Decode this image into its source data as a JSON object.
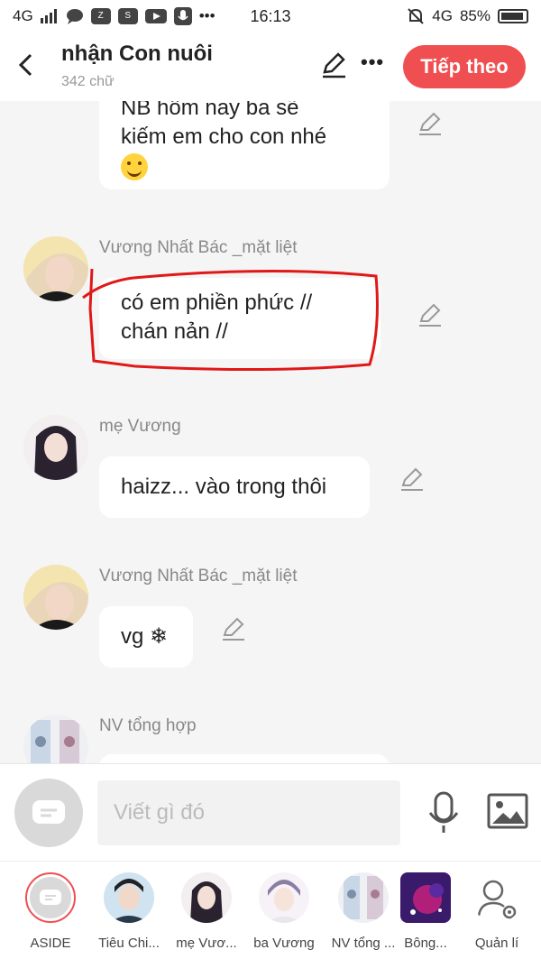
{
  "status_bar": {
    "network_left": "4G",
    "time": "16:13",
    "network_right": "4G",
    "battery": "85%"
  },
  "header": {
    "title": "nhận Con nuôi",
    "subtitle": "342 chữ",
    "next_label": "Tiếp theo"
  },
  "messages": [
    {
      "sender": "",
      "lines": [
        "NB hôm nay ba sẽ",
        "kiếm em cho con nhé"
      ],
      "emoji": "smile-emoji"
    },
    {
      "sender": "Vương Nhất Bác _mặt liệt",
      "lines": [
        "có em phiền phức //",
        "chán nản //"
      ],
      "highlighted": true
    },
    {
      "sender": "mẹ Vương",
      "lines": [
        "haizz... vào trong thôi"
      ]
    },
    {
      "sender": "Vương Nhất Bác _mặt liệt",
      "lines": [
        "vg ❄"
      ]
    },
    {
      "sender": "NV tổng hợp",
      "lines": []
    }
  ],
  "composer": {
    "placeholder": "Viết gì đó"
  },
  "characters": [
    {
      "label": "ASIDE"
    },
    {
      "label": "Tiêu Chi..."
    },
    {
      "label": "mẹ Vươ..."
    },
    {
      "label": "ba Vương"
    },
    {
      "label": "NV tổng ..."
    },
    {
      "label": "Bông..."
    },
    {
      "label": "Quản lí"
    }
  ],
  "colors": {
    "accent": "#f04f52",
    "highlight_stroke": "#e01818",
    "background": "#f5f5f5"
  }
}
